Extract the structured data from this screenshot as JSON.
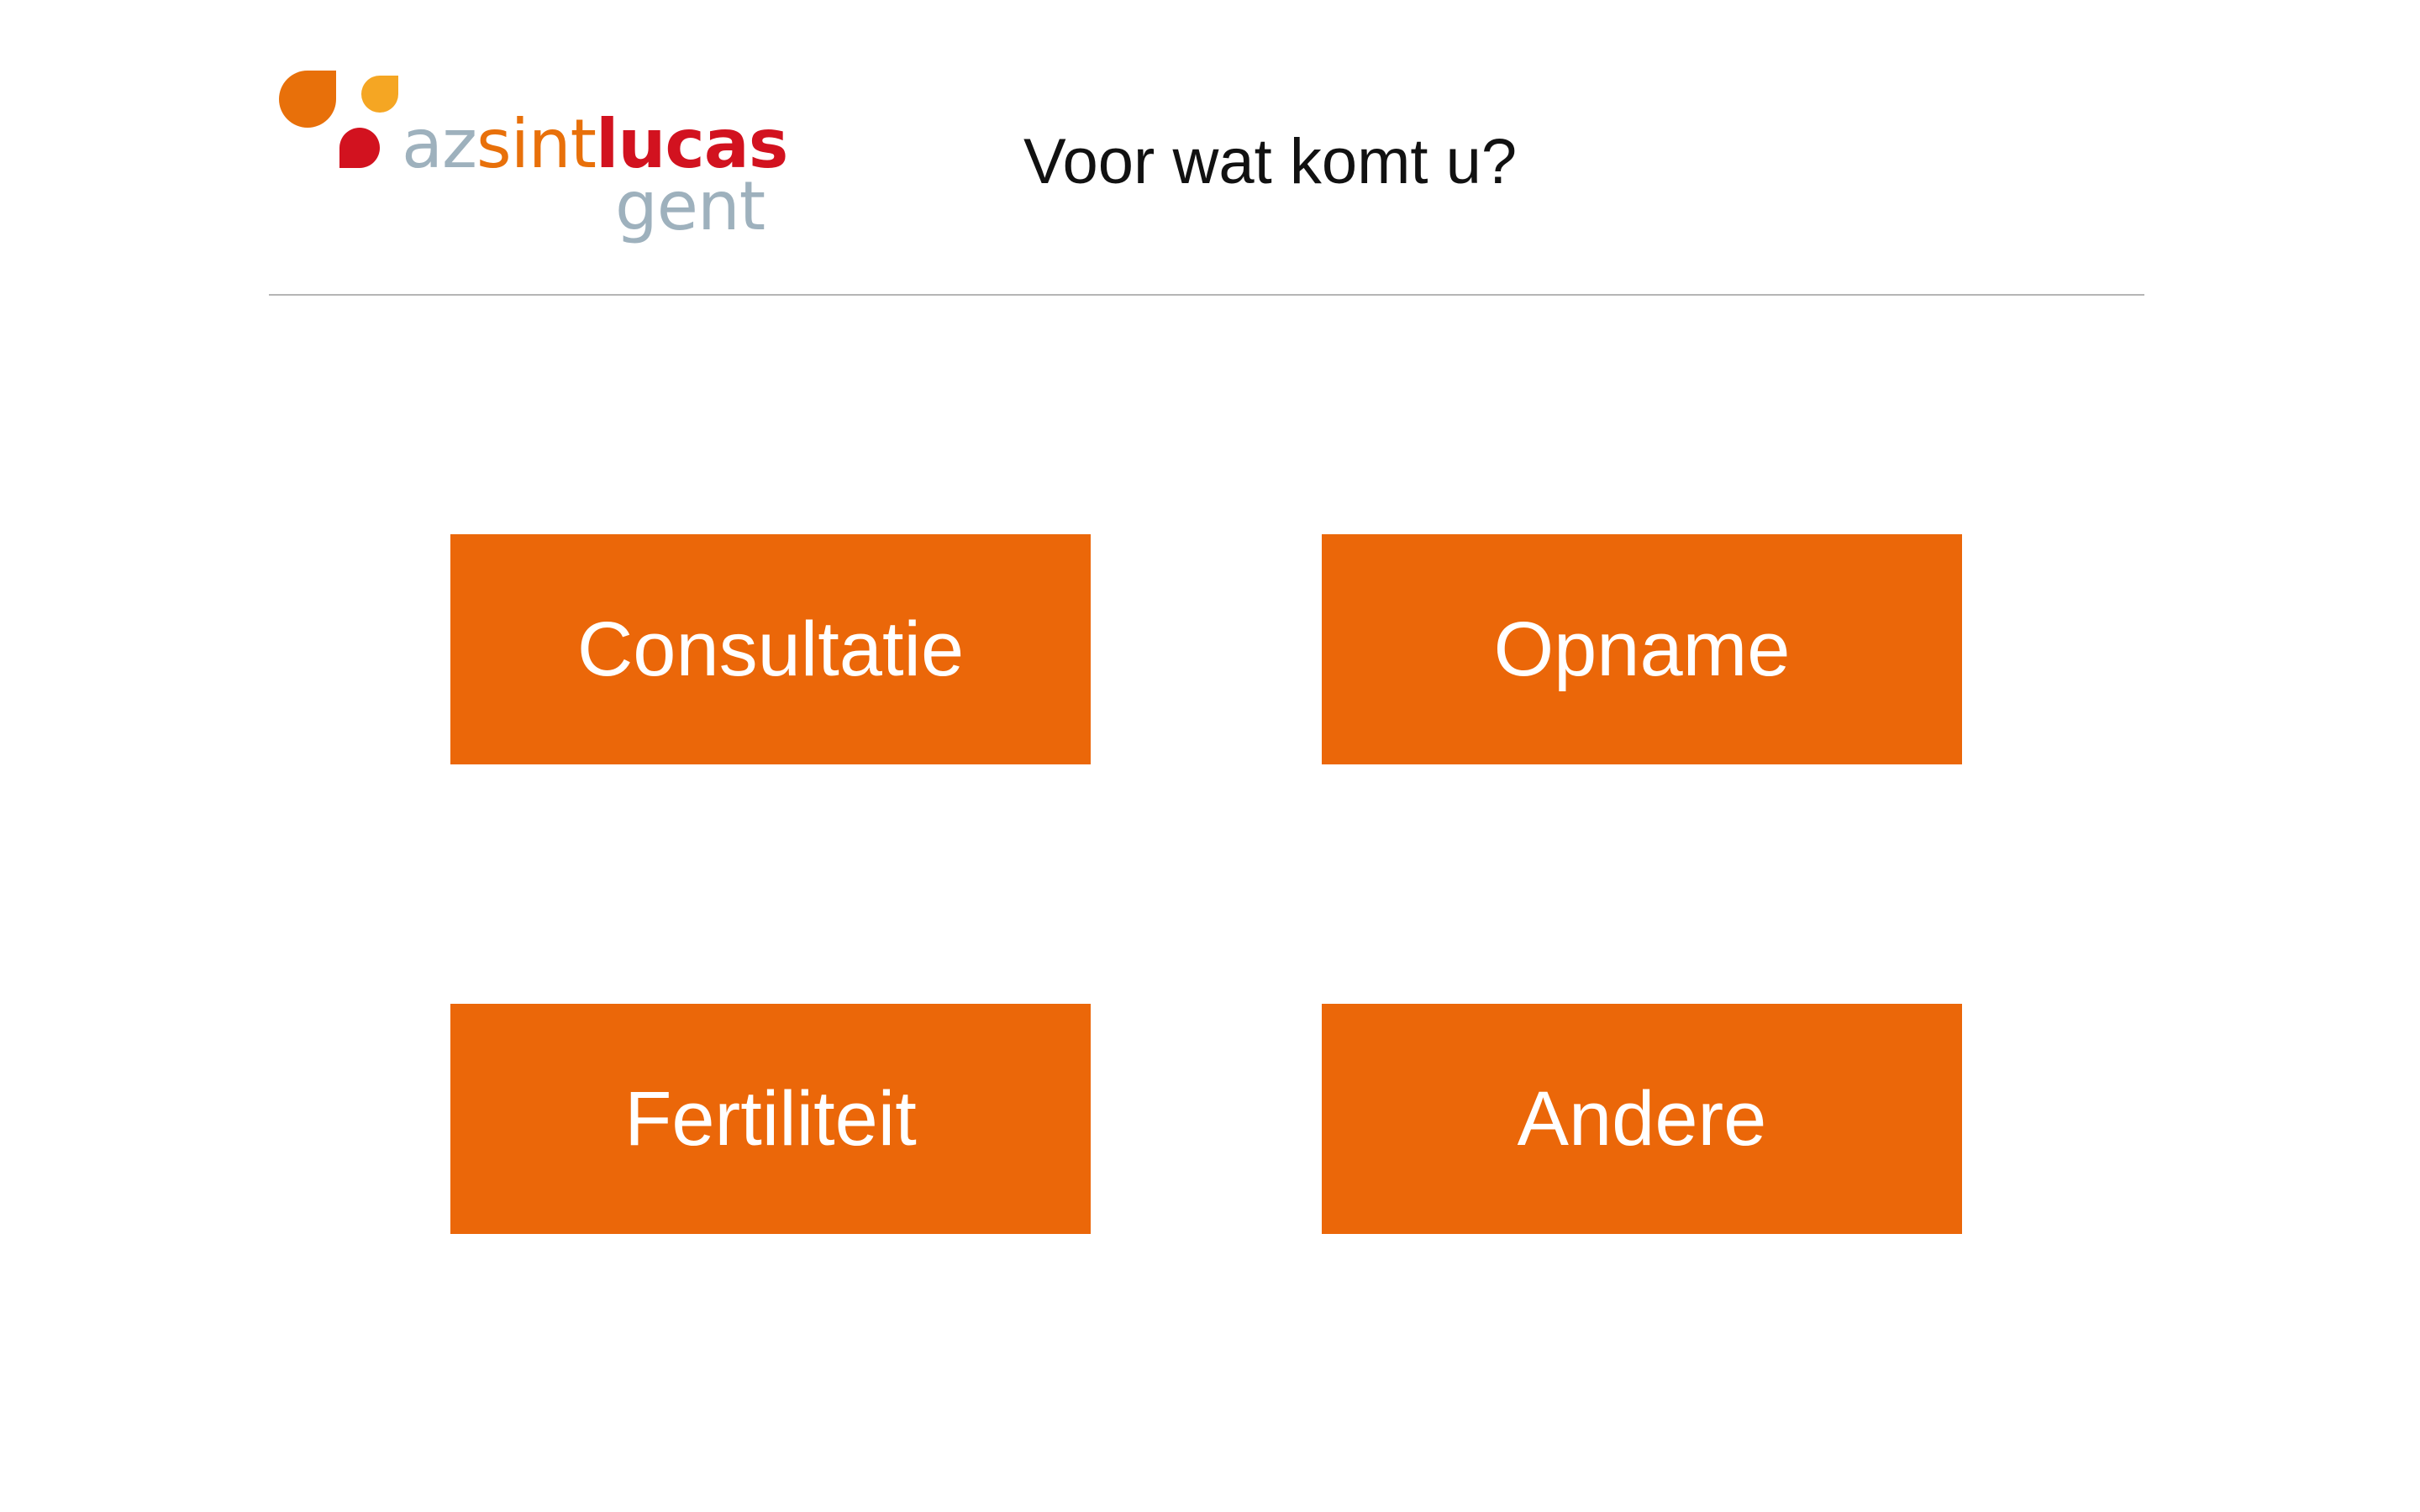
{
  "header": {
    "logo": {
      "text_az": "az",
      "text_sint": "sint",
      "text_lucas": "lucas",
      "text_city": "gent",
      "colors": {
        "orange": "#e8700a",
        "yellow": "#f5a623",
        "red": "#d2121f",
        "grey_blue": "#9eb1bd"
      }
    },
    "title": "Voor wat komt u?"
  },
  "options": {
    "consultatie": "Consultatie",
    "opname": "Opname",
    "fertiliteit": "Fertiliteit",
    "andere": "Andere"
  },
  "colors": {
    "button_background": "#eb6709",
    "button_text": "#ffffff",
    "divider": "#b5b5b5",
    "title_text": "#111111"
  }
}
